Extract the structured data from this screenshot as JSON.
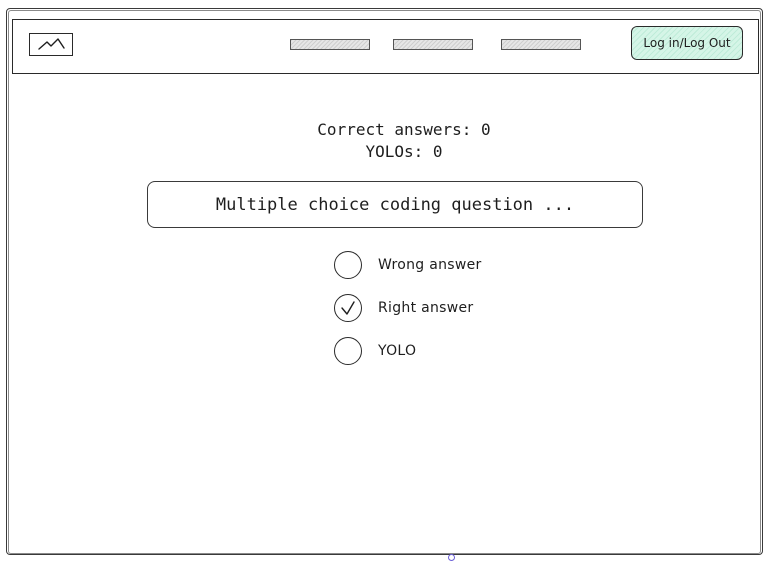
{
  "header": {
    "logo_icon": "image-placeholder-icon",
    "nav_links": [
      "",
      "",
      ""
    ],
    "login_button_label": "Log in/Log Out",
    "login_button_color": "#c3f0dc"
  },
  "score": {
    "correct_answers_text": "Correct answers: 0",
    "yolos_text": "YOLOs: 0"
  },
  "question": {
    "text": "Multiple choice coding question ..."
  },
  "options": [
    {
      "label": "Wrong answer",
      "selected": false
    },
    {
      "label": "Right answer",
      "selected": true
    },
    {
      "label": "YOLO",
      "selected": false
    }
  ],
  "colors": {
    "stroke": "#1e1e1e",
    "nav_fill": "#e6e6e6",
    "accent_handle": "#6b5fd6"
  }
}
